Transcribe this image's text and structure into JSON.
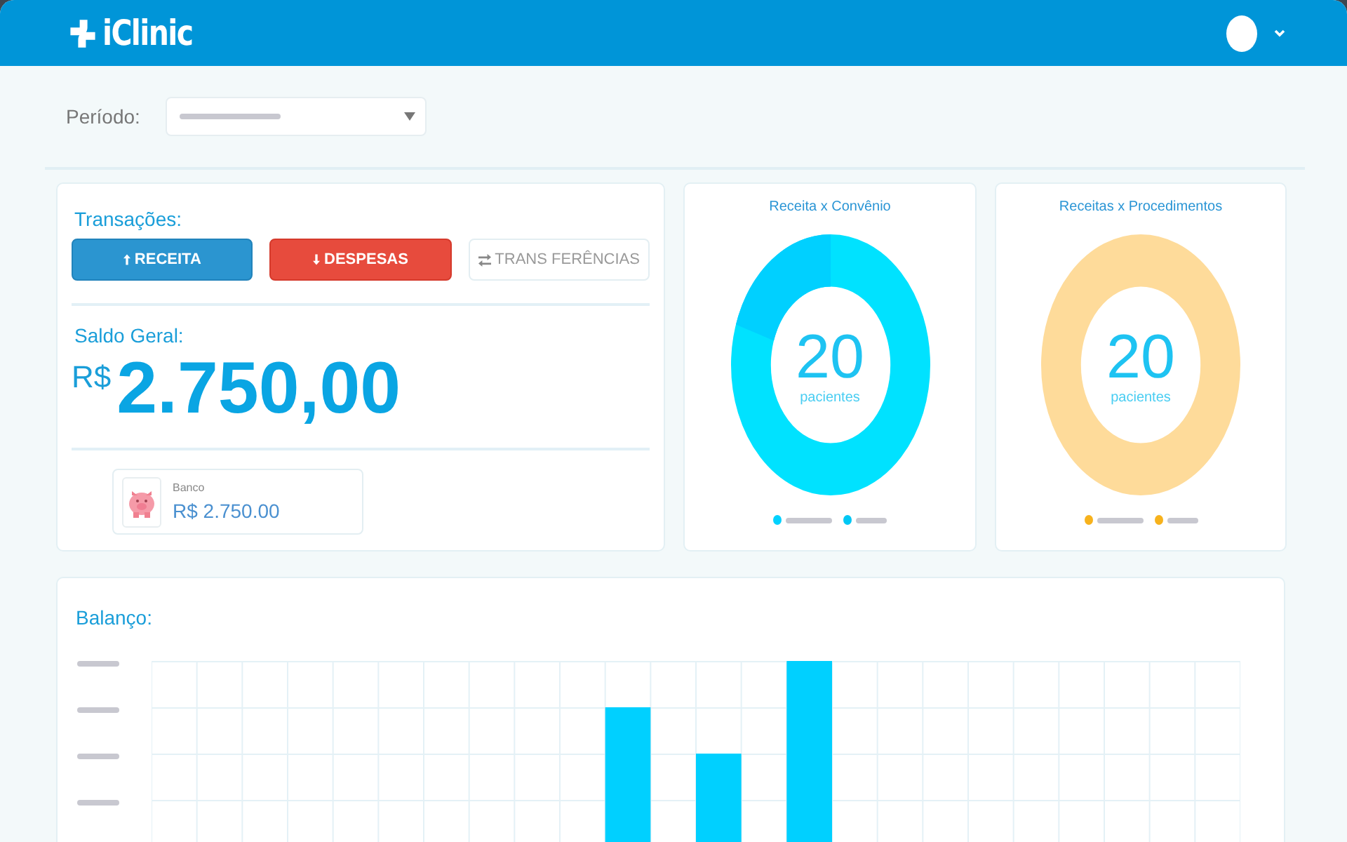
{
  "header": {
    "logo": "iClinic"
  },
  "filter": {
    "label": "Período:"
  },
  "transactions": {
    "title": "Transações:",
    "buttons": [
      {
        "kind": "income",
        "label": "RECEITA"
      },
      {
        "kind": "expense",
        "label": "DESPESAS"
      },
      {
        "kind": "transfer",
        "label": "TRANS FERÊNCIAS"
      }
    ]
  },
  "balance": {
    "title": "Saldo Geral:",
    "currency": "R$",
    "amount": "2.750,00",
    "accounts": [
      {
        "name": "Banco",
        "amount": "R$ 2.750.00"
      }
    ]
  },
  "donuts": [
    {
      "title": "Receita x Convênio",
      "count": "20",
      "caption": "pacientes",
      "legend": [
        {
          "color": "#00d2ff"
        },
        {
          "color": "#00c8f5"
        }
      ]
    },
    {
      "title": "Receitas x Procedimentos",
      "count": "20",
      "caption": "pacientes",
      "legend": [
        {
          "color": "#f7b21c"
        },
        {
          "color": "#f7b21c"
        }
      ]
    }
  ],
  "balance_chart": {
    "title": "Balanço:"
  }
}
